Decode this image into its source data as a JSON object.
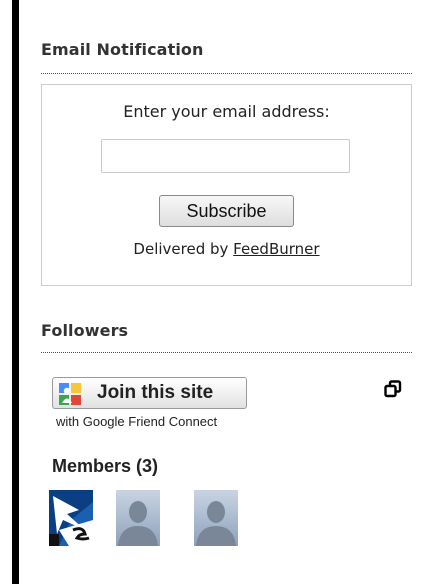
{
  "email_section": {
    "title": "Email Notification",
    "prompt": "Enter your email address:",
    "email_value": "",
    "subscribe_label": "Subscribe",
    "delivered_prefix": "Delivered by ",
    "delivered_link": "FeedBurner"
  },
  "followers_section": {
    "title": "Followers",
    "join_label": "Join this site",
    "join_sub": "with Google Friend Connect",
    "members_label": "Members (3)",
    "members": [
      {
        "avatar_icon": "custom-profile-photo"
      },
      {
        "avatar_icon": "default-user-silhouette-icon"
      },
      {
        "avatar_icon": "default-user-silhouette-icon"
      }
    ]
  },
  "colors": {
    "left_bar": "#000000",
    "box_border": "#cccccc",
    "text": "#222222"
  }
}
